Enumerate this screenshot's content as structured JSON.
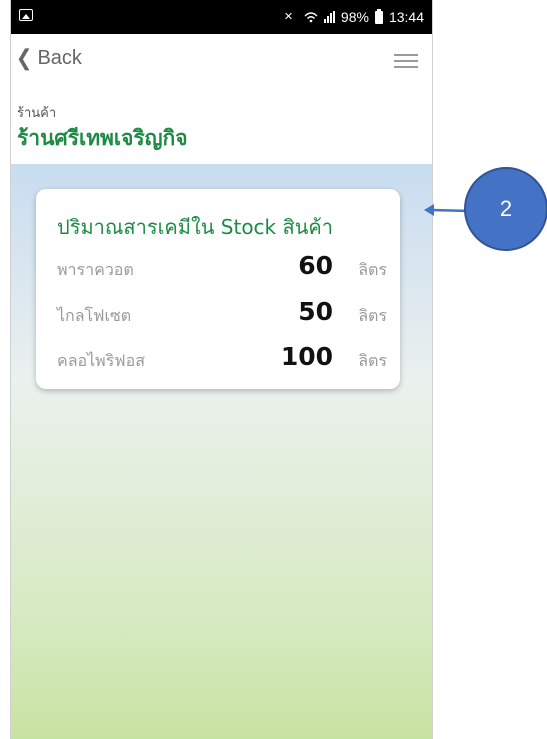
{
  "status_bar": {
    "signal_text": "98%",
    "time": "13:44",
    "icons": [
      "image-icon",
      "mute-icon",
      "wifi-icon",
      "signal-icon",
      "battery-icon"
    ]
  },
  "navbar": {
    "back_label": "Back",
    "back_icon": "chevron-left-icon",
    "menu_icon": "hamburger-menu-icon"
  },
  "header": {
    "caption": "ร้านค้า",
    "shop_name": "ร้านศรีเทพเจริญกิจ"
  },
  "stock_card": {
    "title": "ปริมาณสารเคมีใน Stock สินค้า",
    "items": [
      {
        "name": "พาราควอต",
        "quantity": "60",
        "unit": "ลิตร"
      },
      {
        "name": "ไกลโฟเซต",
        "quantity": "50",
        "unit": "ลิตร"
      },
      {
        "name": "คลอไพริฟอส",
        "quantity": "100",
        "unit": "ลิตร"
      }
    ]
  },
  "annotation": {
    "callout_number": "2",
    "color": "#4472c4"
  },
  "colors": {
    "brand_green": "#1e8b45",
    "gradient_top": "#c8dcf0",
    "gradient_bottom": "#c7e3a2"
  }
}
